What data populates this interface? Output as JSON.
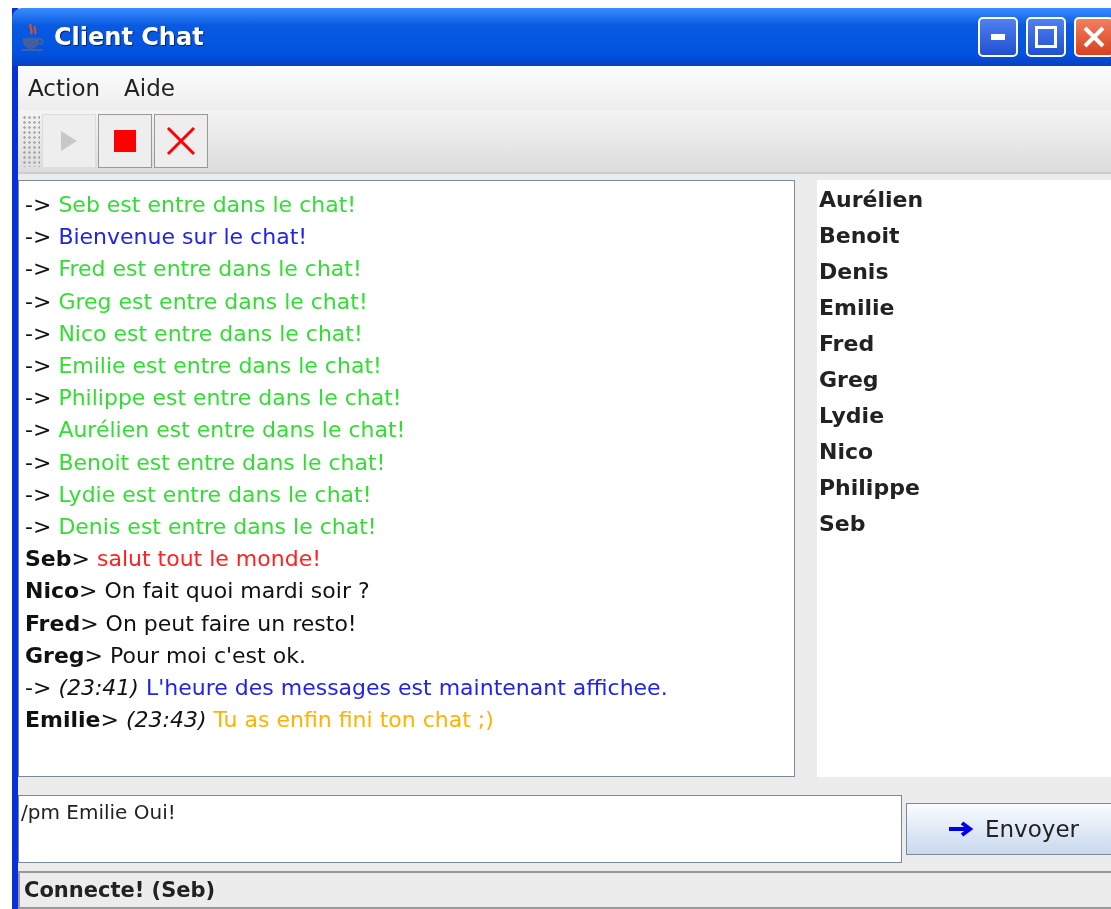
{
  "window": {
    "title": "Client Chat"
  },
  "menu": [
    {
      "label": "Action"
    },
    {
      "label": "Aide"
    }
  ],
  "toolbar": [
    {
      "kind": "play",
      "disabled": true
    },
    {
      "kind": "stop",
      "disabled": false
    },
    {
      "kind": "close",
      "disabled": false
    }
  ],
  "messages": [
    {
      "kind": "system",
      "prefix": "->",
      "text": "Seb est entre dans le chat!",
      "color": "#33dd33"
    },
    {
      "kind": "system",
      "prefix": "->",
      "text": "Bienvenue sur le chat!",
      "color": "#2222ee"
    },
    {
      "kind": "system",
      "prefix": "->",
      "text": "Fred est entre dans le chat!",
      "color": "#33dd33"
    },
    {
      "kind": "system",
      "prefix": "->",
      "text": "Greg est entre dans le chat!",
      "color": "#33dd33"
    },
    {
      "kind": "system",
      "prefix": "->",
      "text": "Nico est entre dans le chat!",
      "color": "#33dd33"
    },
    {
      "kind": "system",
      "prefix": "->",
      "text": "Emilie est entre dans le chat!",
      "color": "#33dd33"
    },
    {
      "kind": "system",
      "prefix": "->",
      "text": "Philippe est entre dans le chat!",
      "color": "#33dd33"
    },
    {
      "kind": "system",
      "prefix": "->",
      "text": "Aurélien est entre dans le chat!",
      "color": "#33dd33"
    },
    {
      "kind": "system",
      "prefix": "->",
      "text": "Benoit est entre dans le chat!",
      "color": "#33dd33"
    },
    {
      "kind": "system",
      "prefix": "->",
      "text": "Lydie est entre dans le chat!",
      "color": "#33dd33"
    },
    {
      "kind": "system",
      "prefix": "->",
      "text": "Denis est entre dans le chat!",
      "color": "#33dd33"
    },
    {
      "kind": "chat",
      "user": "Seb",
      "separator": ">",
      "text": "salut tout le monde!",
      "color": "#ff2222"
    },
    {
      "kind": "chat",
      "user": "Nico",
      "separator": ">",
      "text": "On fait quoi mardi soir ?",
      "color": "#111111"
    },
    {
      "kind": "chat",
      "user": "Fred",
      "separator": ">",
      "text": "On peut faire un resto!",
      "color": "#111111"
    },
    {
      "kind": "chat",
      "user": "Greg",
      "separator": ">",
      "text": "Pour moi c'est ok.",
      "color": "#111111"
    },
    {
      "kind": "system",
      "prefix": "->",
      "time": "(23:41)",
      "text": "L'heure des messages est maintenant affichee.",
      "color": "#2222ee"
    },
    {
      "kind": "chat",
      "user": "Emilie",
      "separator": ">",
      "time": "(23:43)",
      "text": "Tu as enfin fini ton chat ;)",
      "color": "#ffb300"
    }
  ],
  "users": [
    "Aurélien",
    "Benoit",
    "Denis",
    "Emilie",
    "Fred",
    "Greg",
    "Lydie",
    "Nico",
    "Philippe",
    "Seb"
  ],
  "input": {
    "value": "/pm Emilie Oui!"
  },
  "send_button": {
    "label": "Envoyer"
  },
  "status_bar": "Connecte!  (Seb)"
}
